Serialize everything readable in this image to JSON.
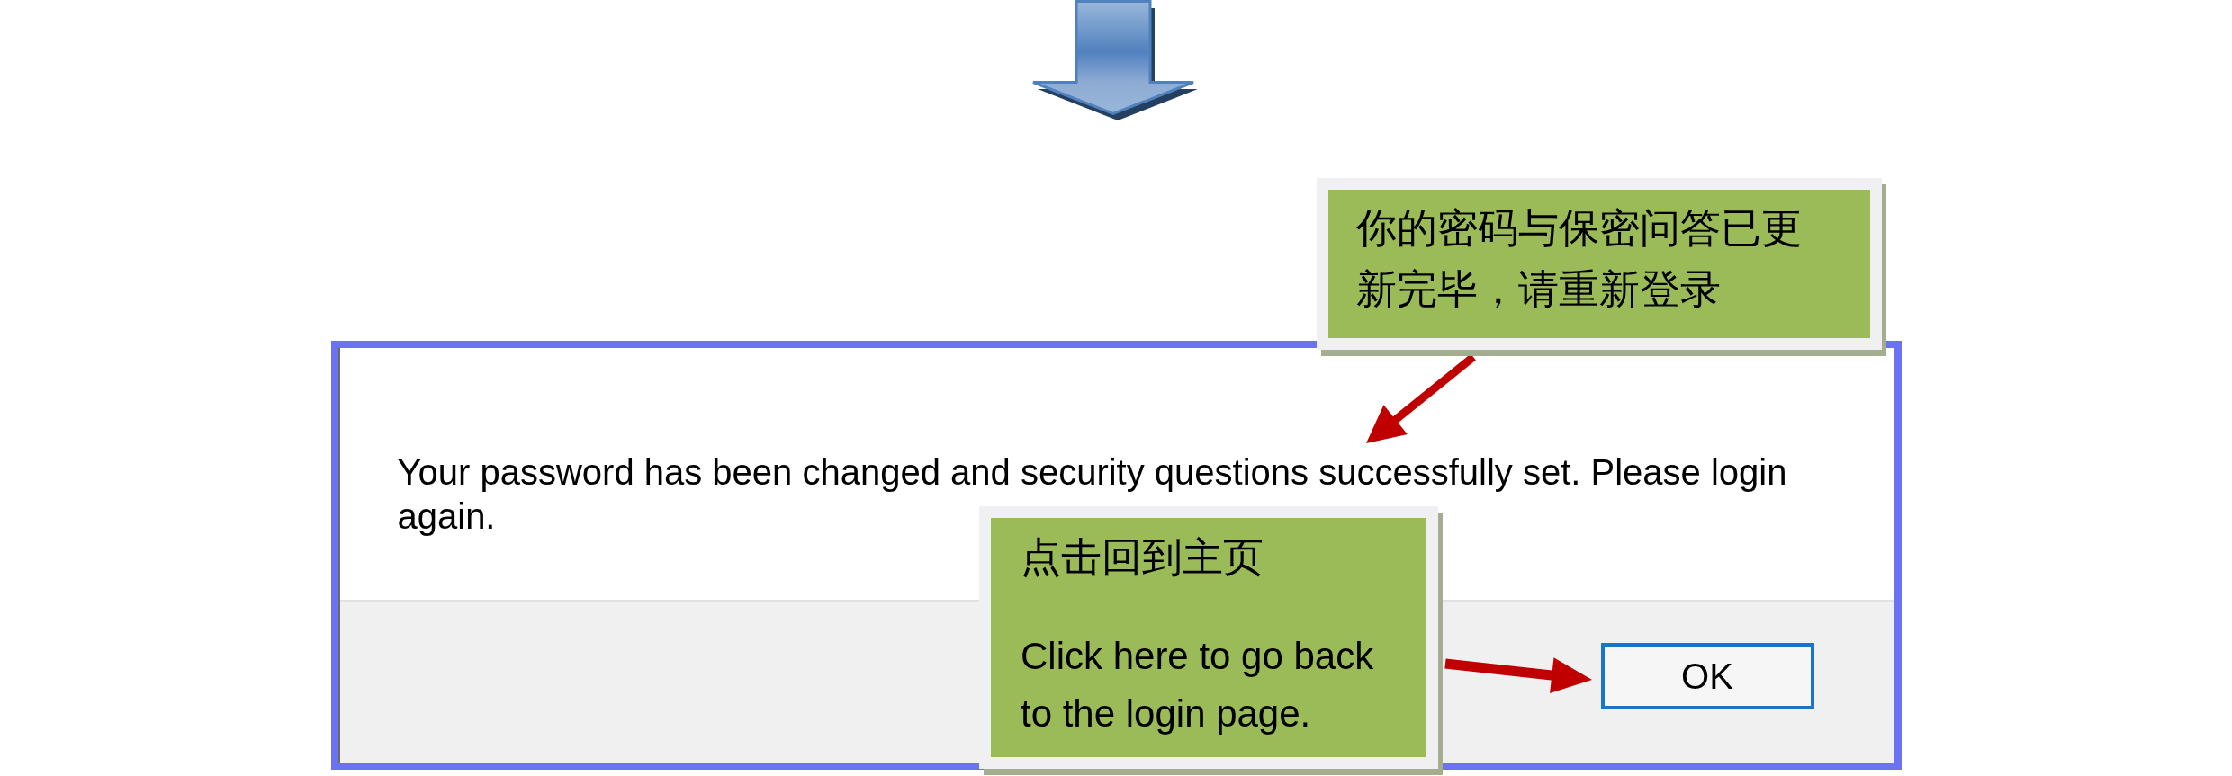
{
  "dialog": {
    "message": "Your password has been changed and security questions successfully set. Please login again.",
    "buttons": [
      "OK"
    ]
  },
  "callouts": [
    {
      "paragraphs": [
        {
          "kind": "chinese",
          "text": "你的密码与保密问答已更新完毕，请重新登录"
        }
      ]
    },
    {
      "paragraphs": [
        {
          "kind": "chinese",
          "text": "点击回到主页"
        },
        {
          "kind": "english",
          "text": "Click here to go back to the login page."
        }
      ]
    }
  ]
}
